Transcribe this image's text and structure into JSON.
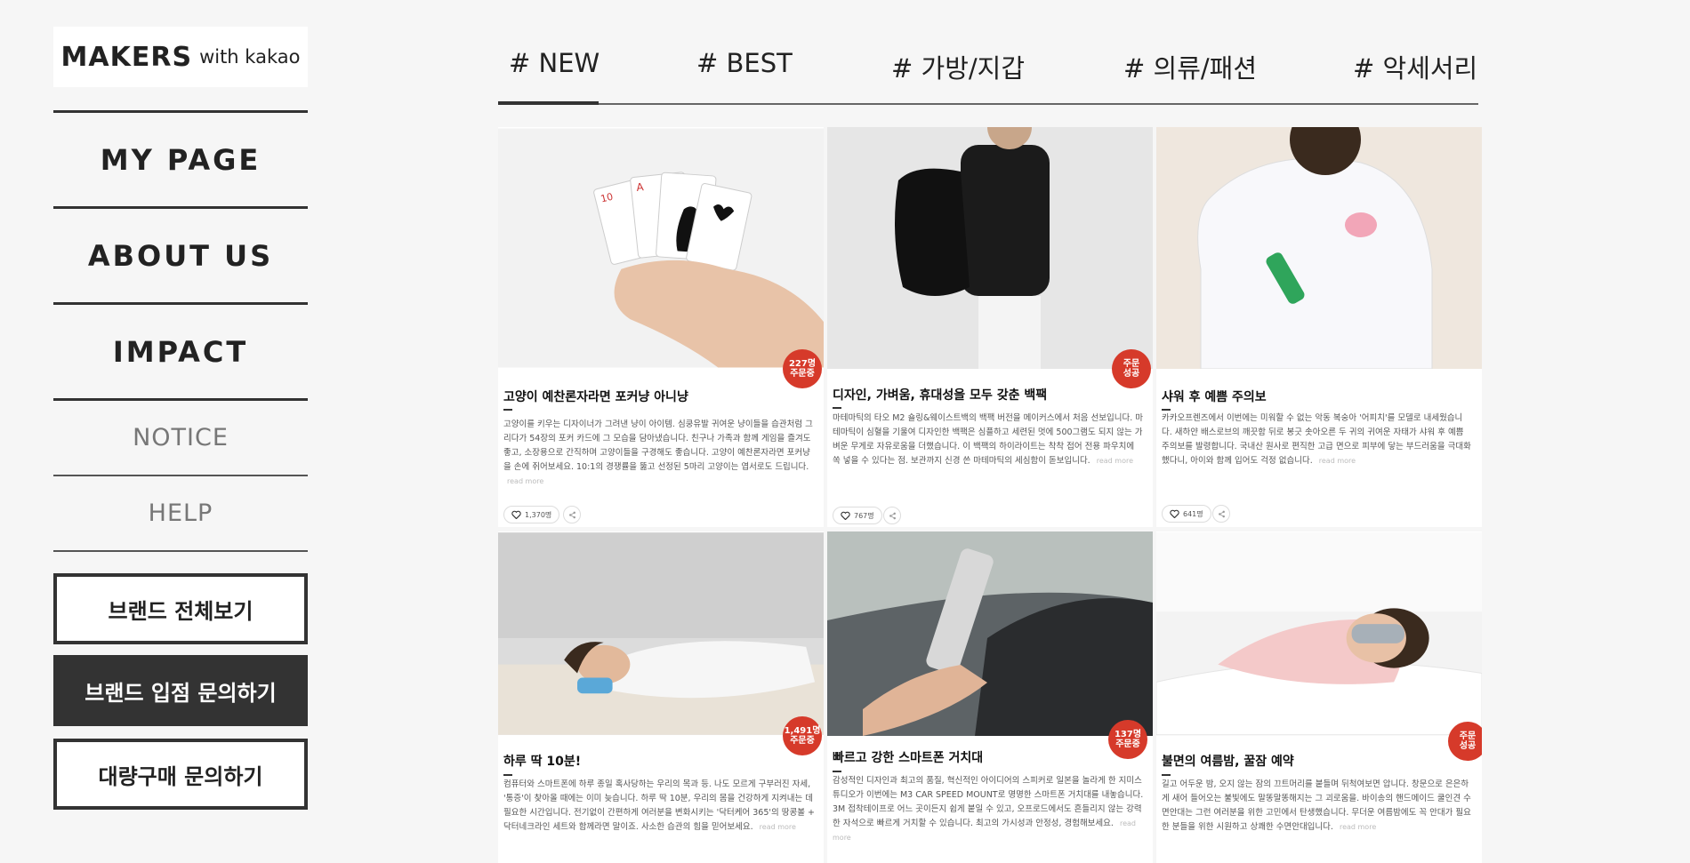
{
  "logo": {
    "main": "MAKERS",
    "sub": "with kakao"
  },
  "menu": [
    {
      "label": "MY PAGE"
    },
    {
      "label": "ABOUT US"
    },
    {
      "label": "IMPACT"
    }
  ],
  "submenu": [
    {
      "label": "NOTICE"
    },
    {
      "label": "HELP"
    }
  ],
  "buttons": {
    "brand_all": "브랜드 전체보기",
    "brand_inquiry": "브랜드 입점 문의하기",
    "bulk_inquiry": "대량구매 문의하기"
  },
  "tabs": [
    {
      "label": "# NEW",
      "active": true
    },
    {
      "label": "# BEST"
    },
    {
      "label": "# 가방/지갑"
    },
    {
      "label": "# 의류/패션"
    },
    {
      "label": "# 악세서리"
    }
  ],
  "colors": {
    "badge": "#d63a2a",
    "accent": "#333333"
  },
  "cards": [
    {
      "title": "고양이 예찬론자라면 포커냥 아니냥",
      "badge": [
        "227명",
        "주문중"
      ],
      "desc": "고양이를 키우는 디자이너가 그려낸 냥이 아이템. 심쿵유발 귀여운 냥이들을 습관처럼 그리다가 54장의 포커 카드에 그 모습을 담아냈습니다. 친구나 가족과 함께 게임을 즐겨도 좋고, 소장용으로 간직하며 고양이들을 구경해도 좋습니다. 고양이 예찬론자라면 포커냥을 손에 쥐어보세요. 10:1의 경쟁률을 뚫고 선정된 5마리 고양이는 엽서로도 드립니다.",
      "readmore": "read more",
      "likes": "1,370명"
    },
    {
      "title": "디자인, 가벼움, 휴대성을 모두 갖춘 백팩",
      "badge": [
        "주문",
        "성공"
      ],
      "desc": "마테마틱의 타오 M2 숄링&웨이스트백의 백팩 버전을 메이커스에서 처음 선보입니다. 마테마틱이 심혈을 기울여 디자인한 백팩은 심플하고 세련된 멋에 500그램도 되지 않는 가벼운 무게로 자유로움을 더했습니다. 이 백팩의 하이라이트는 착착 접어 전용 파우치에 쏙 넣을 수 있다는 점. 보관까지 신경 쓴 마테마틱의 세심함이 돋보입니다.",
      "readmore": "read more",
      "likes": "767명"
    },
    {
      "title": "샤워 후 예쁨 주의보",
      "badge": [],
      "desc": "카카오프렌즈에서 이번에는 미워할 수 없는 악동 복숭아 '어피치'를 모델로 내세웠습니다. 새하얀 배스로브의 깨끗함 뒤로 봉긋 솟아오른 두 귀의 귀여운 자태가 샤워 후 예쁨 주의보를 발령합니다. 국내산 원사로 편직한 고급 면으로 피부에 닿는 부드러움을 극대화했다니, 아이와 함께 입어도 걱정 없습니다.",
      "readmore": "read more",
      "likes": "641명"
    },
    {
      "title": "하루 딱 10분!",
      "badge": [
        "1,491명",
        "주문중"
      ],
      "desc": "컴퓨터와 스마트폰에 하루 종일 혹사당하는 우리의 목과 등. 나도 모르게 구부러진 자세, '통증'이 찾아올 때에는 이미 늦습니다. 하루 딱 10분, 우리의 몸을 건강하게 지켜내는 데 필요한 시간입니다. 전기없이 간편하게 여러분을 변화시키는 '닥터케어 365'의 땅콩볼 + 닥터네크라인 세트와 함께라면 말이죠. 사소한 습관의 힘을 믿어보세요.",
      "readmore": "read more",
      "likes": ""
    },
    {
      "title": "빠르고 강한 스마트폰 거치대",
      "badge": [
        "137명",
        "주문중"
      ],
      "desc": "감성적인 디자인과 최고의 품질, 혁신적인 아이디어의 스피커로 일본을 놀라게 한 지미스튜디오가 이번에는 M3 CAR SPEED MOUNT로 명명한 스마트폰 거치대를 내놓습니다. 3M 접착테이프로 어느 곳이든지 쉽게 붙일 수 있고, 오프로드에서도 흔들리지 않는 강력한 자석으로 빠르게 거치할 수 있습니다. 최고의 가시성과 안정성, 경험해보세요.",
      "readmore": "read more",
      "likes": ""
    },
    {
      "title": "불면의 여름밤, 꿀잠 예약",
      "badge": [
        "주문",
        "성공"
      ],
      "desc": "길고 어두운 밤, 오지 않는 잠의 끄트머리를 붙들며 뒤척여보면 압니다. 창문으로 은은하게 새어 들어오는 불빛에도 말똥말똥해지는 그 괴로움을. 바이송의 핸드메이드 쿨인견 수면안대는 그런 여러분을 위한 고민에서 탄생했습니다. 무더운 여름밤에도 꼭 안대가 필요한 분들을 위한 시원하고 상쾌한 수면안대입니다.",
      "readmore": "read more",
      "likes": ""
    }
  ]
}
